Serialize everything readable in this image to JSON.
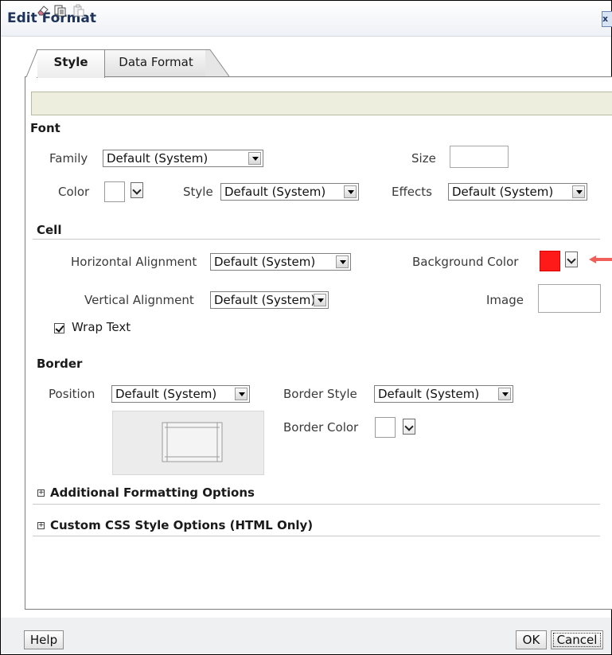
{
  "dialog": {
    "title": "Edit Format",
    "close_label": "x"
  },
  "tabs": [
    {
      "label": "Style"
    },
    {
      "label": "Data Format"
    }
  ],
  "toolbar": {
    "icons": [
      "eraser-icon",
      "copy-icon",
      "paste-icon"
    ]
  },
  "font": {
    "section_label": "Font",
    "family_label": "Family",
    "family_value": "Default (System)",
    "size_label": "Size",
    "size_value": "",
    "color_label": "Color",
    "style_label": "Style",
    "style_value": "Default (System)",
    "effects_label": "Effects",
    "effects_value": "Default (System)"
  },
  "cell": {
    "section_label": "Cell",
    "halign_label": "Horizontal Alignment",
    "halign_value": "Default (System)",
    "bgcolor_label": "Background Color",
    "bgcolor_value": "#ff1a1a",
    "valign_label": "Vertical Alignment",
    "valign_value": "Default (System)",
    "image_label": "Image",
    "wrap_text_label": "Wrap Text",
    "wrap_text_checked": true
  },
  "border": {
    "section_label": "Border",
    "position_label": "Position",
    "position_value": "Default (System)",
    "style_label": "Border Style",
    "style_value": "Default (System)",
    "color_label": "Border Color"
  },
  "expanders": [
    {
      "label": "Additional Formatting Options"
    },
    {
      "label": "Custom CSS Style Options (HTML Only)"
    }
  ],
  "footer": {
    "help_label": "Help",
    "ok_label": "OK",
    "cancel_label": "Cancel"
  },
  "colors": {
    "accent": "#1e3359",
    "annotation_arrow": "#f0605a",
    "background_swatch": "#ff1a1a"
  }
}
